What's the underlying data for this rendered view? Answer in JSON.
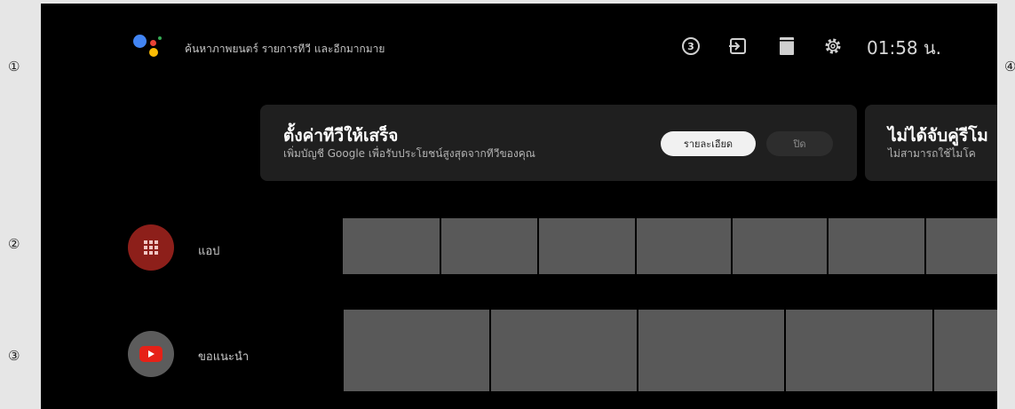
{
  "callouts": [
    "①",
    "②",
    "③",
    "④"
  ],
  "topbar": {
    "search_hint": "ค้นหาภาพยนตร์ รายการทีวี และอีกมากมาย",
    "notification_count": "3",
    "clock": "01:58 น."
  },
  "setup_card": {
    "title": "ตั้งค่าทีวีให้เสร็จ",
    "subtitle": "เพิ่มบัญชี Google เพื่อรับประโยชน์สูงสุดจากทีวีของคุณ",
    "details_button": "รายละเอียด",
    "close_button": "ปิด"
  },
  "remote_card": {
    "title": "ไม่ได้จับคู่รีโม",
    "subtitle": "ไม่สามารถใช้ไมโค"
  },
  "rows": {
    "apps_label": "แอป",
    "recommended_label": "ขอแนะนำ"
  },
  "colors": {
    "screen_bg": "#000000",
    "card_bg": "#1f1f1f",
    "tile": "#595959",
    "apps_icon_bg": "#8d1f1a",
    "youtube_red": "#e62117"
  },
  "icons": [
    "google-assistant-icon",
    "notification-count-icon",
    "input-source-icon",
    "storage-icon",
    "settings-gear-icon",
    "apps-grid-icon",
    "youtube-icon"
  ]
}
